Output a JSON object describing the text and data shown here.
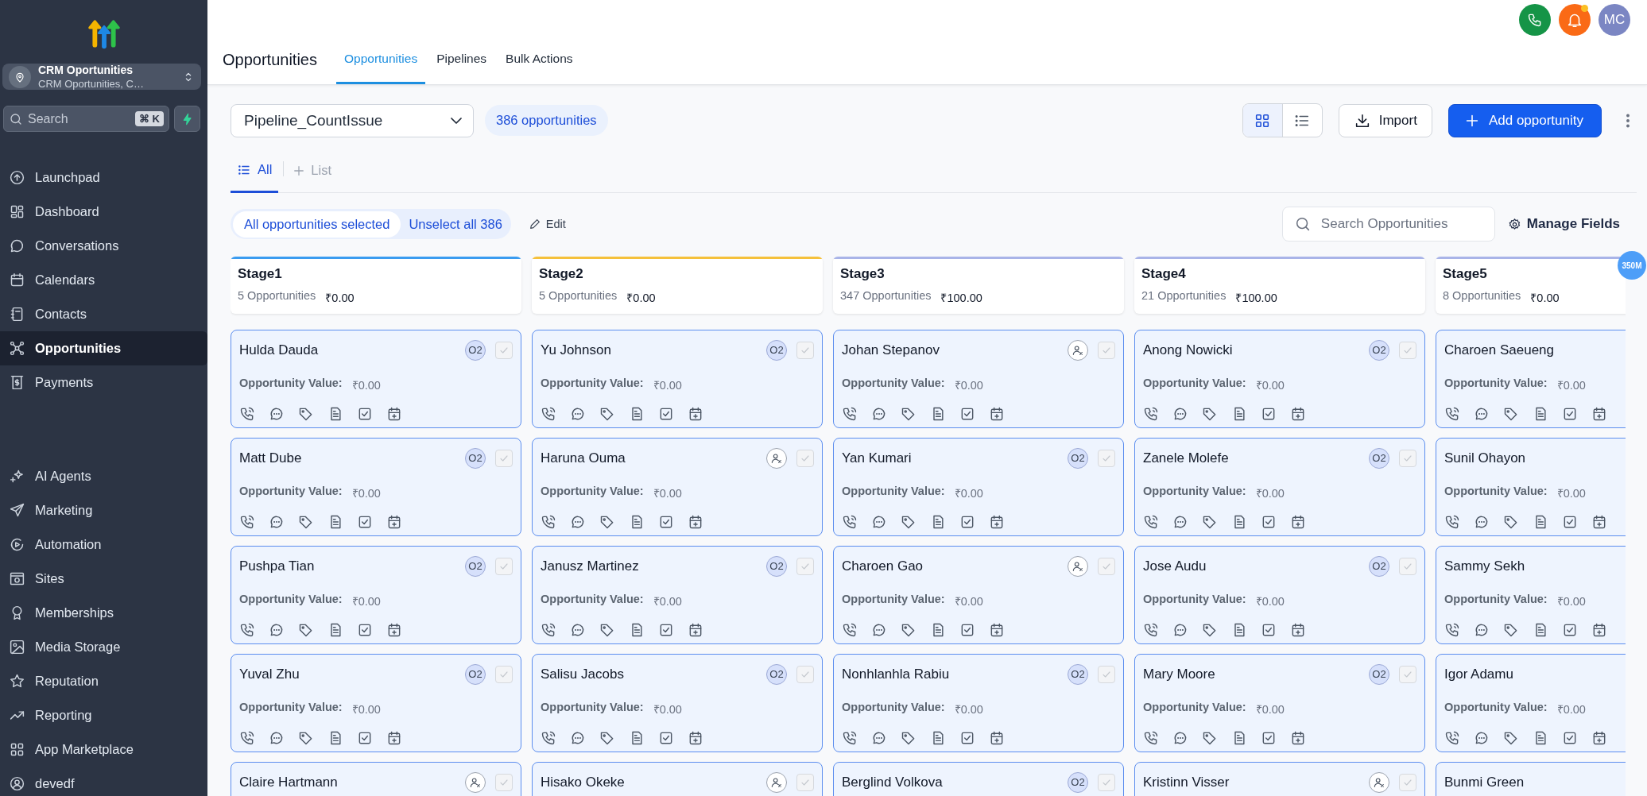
{
  "sidebar": {
    "account": {
      "name": "CRM Oportunities",
      "subtitle": "CRM Oportunities, C…"
    },
    "search": {
      "placeholder": "Search",
      "shortcut": "⌘ K"
    },
    "nav_groups": [
      [
        {
          "label": "Launchpad",
          "selected": false
        },
        {
          "label": "Dashboard",
          "selected": false
        },
        {
          "label": "Conversations",
          "selected": false
        },
        {
          "label": "Calendars",
          "selected": false
        },
        {
          "label": "Contacts",
          "selected": false
        },
        {
          "label": "Opportunities",
          "selected": true
        },
        {
          "label": "Payments",
          "selected": false
        }
      ],
      [
        {
          "label": "AI Agents",
          "selected": false
        },
        {
          "label": "Marketing",
          "selected": false
        },
        {
          "label": "Automation",
          "selected": false
        },
        {
          "label": "Sites",
          "selected": false
        },
        {
          "label": "Memberships",
          "selected": false
        },
        {
          "label": "Media Storage",
          "selected": false
        },
        {
          "label": "Reputation",
          "selected": false
        },
        {
          "label": "Reporting",
          "selected": false
        },
        {
          "label": "App Marketplace",
          "selected": false
        },
        {
          "label": "devedf",
          "selected": false
        }
      ]
    ]
  },
  "header": {
    "notification": true,
    "user_initials": "MC",
    "title": "Opportunities",
    "tabs": [
      {
        "label": "Opportunities",
        "selected": true
      },
      {
        "label": "Pipelines",
        "selected": false
      },
      {
        "label": "Bulk Actions",
        "selected": false
      }
    ]
  },
  "toolbar": {
    "pipeline": "Pipeline_CountIssue",
    "count_badge": "386 opportunities",
    "view_modes": [
      {
        "selected": true
      },
      {
        "selected": false
      }
    ],
    "import_label": "Import",
    "add_label": "Add opportunity"
  },
  "views": {
    "tabs": [
      {
        "label": "All",
        "selected": true
      }
    ],
    "add_label": "List"
  },
  "selection": {
    "selected_label": "All opportunities selected",
    "unselect_label": "Unselect all 386",
    "edit_label": "Edit",
    "search_placeholder": "Search Opportunities",
    "manage_label": "Manage Fields"
  },
  "floating_badge": "350M",
  "stages": [
    {
      "name": "Stage1",
      "count": "5 Opportunities",
      "total": "₹0.00",
      "color": "#3b9cf0",
      "cards": [
        {
          "name": "Hulda Dauda",
          "value_label": "Opportunity Value:",
          "value": "₹0.00",
          "assignee": {
            "kind": "avatar",
            "initials": "O2"
          },
          "checked": false
        },
        {
          "name": "Matt Dube",
          "value_label": "Opportunity Value:",
          "value": "₹0.00",
          "assignee": {
            "kind": "avatar",
            "initials": "O2"
          },
          "checked": false
        },
        {
          "name": "Pushpa Tian",
          "value_label": "Opportunity Value:",
          "value": "₹0.00",
          "assignee": {
            "kind": "avatar",
            "initials": "O2"
          },
          "checked": false
        },
        {
          "name": "Yuval Zhu",
          "value_label": "Opportunity Value:",
          "value": "₹0.00",
          "assignee": {
            "kind": "avatar",
            "initials": "O2"
          },
          "checked": false
        },
        {
          "name": "Claire Hartmann",
          "assignee": {
            "kind": "unassigned"
          },
          "checked": false
        }
      ]
    },
    {
      "name": "Stage2",
      "count": "5 Opportunities",
      "total": "₹0.00",
      "color": "#f5c13b",
      "cards": [
        {
          "name": "Yu Johnson",
          "value_label": "Opportunity Value:",
          "value": "₹0.00",
          "assignee": {
            "kind": "avatar",
            "initials": "O2"
          },
          "checked": false
        },
        {
          "name": "Haruna Ouma",
          "value_label": "Opportunity Value:",
          "value": "₹0.00",
          "assignee": {
            "kind": "unassigned"
          },
          "checked": false
        },
        {
          "name": "Janusz Martinez",
          "value_label": "Opportunity Value:",
          "value": "₹0.00",
          "assignee": {
            "kind": "avatar",
            "initials": "O2"
          },
          "checked": false
        },
        {
          "name": "Salisu Jacobs",
          "value_label": "Opportunity Value:",
          "value": "₹0.00",
          "assignee": {
            "kind": "avatar",
            "initials": "O2"
          },
          "checked": false
        },
        {
          "name": "Hisako Okeke",
          "assignee": {
            "kind": "unassigned"
          },
          "checked": false
        }
      ]
    },
    {
      "name": "Stage3",
      "count": "347 Opportunities",
      "total": "₹100.00",
      "color": "#a9b4e8",
      "cards": [
        {
          "name": "Johan Stepanov",
          "value_label": "Opportunity Value:",
          "value": "₹0.00",
          "assignee": {
            "kind": "unassigned"
          },
          "checked": false
        },
        {
          "name": "Yan Kumari",
          "value_label": "Opportunity Value:",
          "value": "₹0.00",
          "assignee": {
            "kind": "avatar",
            "initials": "O2"
          },
          "checked": false
        },
        {
          "name": "Charoen Gao",
          "value_label": "Opportunity Value:",
          "value": "₹0.00",
          "assignee": {
            "kind": "unassigned"
          },
          "checked": false
        },
        {
          "name": "Nonhlanhla Rabiu",
          "value_label": "Opportunity Value:",
          "value": "₹0.00",
          "assignee": {
            "kind": "avatar",
            "initials": "O2"
          },
          "checked": false
        },
        {
          "name": "Berglind Volkova",
          "assignee": {
            "kind": "avatar",
            "initials": "O2"
          },
          "checked": false
        }
      ]
    },
    {
      "name": "Stage4",
      "count": "21 Opportunities",
      "total": "₹100.00",
      "color": "#a9b4e8",
      "cards": [
        {
          "name": "Anong Nowicki",
          "value_label": "Opportunity Value:",
          "value": "₹0.00",
          "assignee": {
            "kind": "avatar",
            "initials": "O2"
          },
          "checked": false
        },
        {
          "name": "Zanele Molefe",
          "value_label": "Opportunity Value:",
          "value": "₹0.00",
          "assignee": {
            "kind": "avatar",
            "initials": "O2"
          },
          "checked": false
        },
        {
          "name": "Jose Audu",
          "value_label": "Opportunity Value:",
          "value": "₹0.00",
          "assignee": {
            "kind": "avatar",
            "initials": "O2"
          },
          "checked": false
        },
        {
          "name": "Mary Moore",
          "value_label": "Opportunity Value:",
          "value": "₹0.00",
          "assignee": {
            "kind": "avatar",
            "initials": "O2"
          },
          "checked": false
        },
        {
          "name": "Kristinn Visser",
          "assignee": {
            "kind": "unassigned"
          },
          "checked": false
        }
      ]
    },
    {
      "name": "Stage5",
      "count": "8 Opportunities",
      "total": "₹0.00",
      "color": "#a9b4e8",
      "cards": [
        {
          "name": "Charoen Saeueng",
          "value_label": "Opportunity Value:",
          "value": "₹0.00"
        },
        {
          "name": "Sunil Ohayon",
          "value_label": "Opportunity Value:",
          "value": "₹0.00"
        },
        {
          "name": "Sammy Sekh",
          "value_label": "Opportunity Value:",
          "value": "₹0.00"
        },
        {
          "name": "Igor Adamu",
          "value_label": "Opportunity Value:",
          "value": "₹0.00"
        },
        {
          "name": "Bunmi Green"
        }
      ]
    }
  ]
}
